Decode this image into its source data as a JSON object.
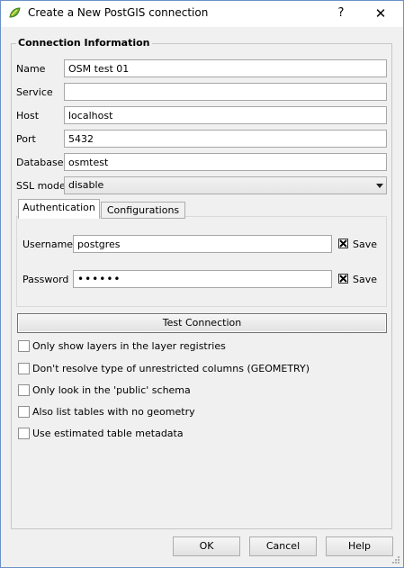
{
  "window": {
    "title": "Create a New PostGIS connection",
    "help_glyph": "?",
    "close_glyph": "✕"
  },
  "group": {
    "title": "Connection Information"
  },
  "fields": {
    "name": {
      "label": "Name",
      "value": "OSM test 01"
    },
    "service": {
      "label": "Service",
      "value": ""
    },
    "host": {
      "label": "Host",
      "value": "localhost"
    },
    "port": {
      "label": "Port",
      "value": "5432"
    },
    "database": {
      "label": "Database",
      "value": "osmtest"
    },
    "ssl": {
      "label": "SSL mode",
      "value": "disable"
    }
  },
  "tabs": [
    {
      "label": "Authentication",
      "active": true
    },
    {
      "label": "Configurations",
      "active": false
    }
  ],
  "auth": {
    "username": {
      "label": "Username",
      "value": "postgres",
      "save_label": "Save",
      "save_checked": true
    },
    "password": {
      "label": "Password",
      "value": "••••••",
      "save_label": "Save",
      "save_checked": true
    }
  },
  "test_connection_label": "Test Connection",
  "options": [
    {
      "label": "Only show layers in the layer registries",
      "checked": false
    },
    {
      "label": "Don't resolve type of unrestricted columns (GEOMETRY)",
      "checked": false
    },
    {
      "label": "Only look in the 'public' schema",
      "checked": false
    },
    {
      "label": "Also list tables with no geometry",
      "checked": false
    },
    {
      "label": "Use estimated table metadata",
      "checked": false
    }
  ],
  "buttons": {
    "ok": "OK",
    "cancel": "Cancel",
    "help": "Help"
  },
  "colors": {
    "window_border": "#6b8fc7",
    "dialog_bg": "#f0f0f0",
    "qgis_icon_green": "#6ab539"
  }
}
